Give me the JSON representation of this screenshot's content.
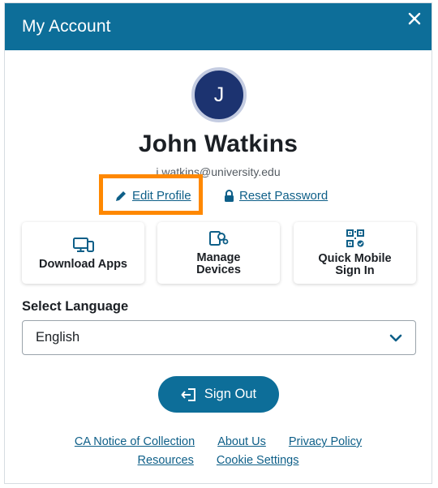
{
  "header": {
    "title": "My Account"
  },
  "profile": {
    "initial": "J",
    "name": "John Watkins",
    "email": "j.watkins@university.edu"
  },
  "links": {
    "edit_profile": "Edit Profile",
    "reset_password": "Reset Password"
  },
  "cards": [
    {
      "label": "Download Apps",
      "icon": "devices-icon"
    },
    {
      "label": "Manage Devices",
      "icon": "manage-devices-icon"
    },
    {
      "label": "Quick Mobile Sign In",
      "icon": "qr-code-icon"
    }
  ],
  "language": {
    "label": "Select Language",
    "selected": "English"
  },
  "signout": {
    "label": "Sign Out"
  },
  "footer": {
    "ca_notice": "CA Notice of Collection",
    "about": "About Us",
    "privacy": "Privacy Policy",
    "resources": "Resources",
    "cookies": "Cookie Settings"
  },
  "colors": {
    "brand": "#0d6e99",
    "avatar_bg": "#1c3370",
    "highlight": "#ff8800",
    "link": "#0e5f88"
  }
}
